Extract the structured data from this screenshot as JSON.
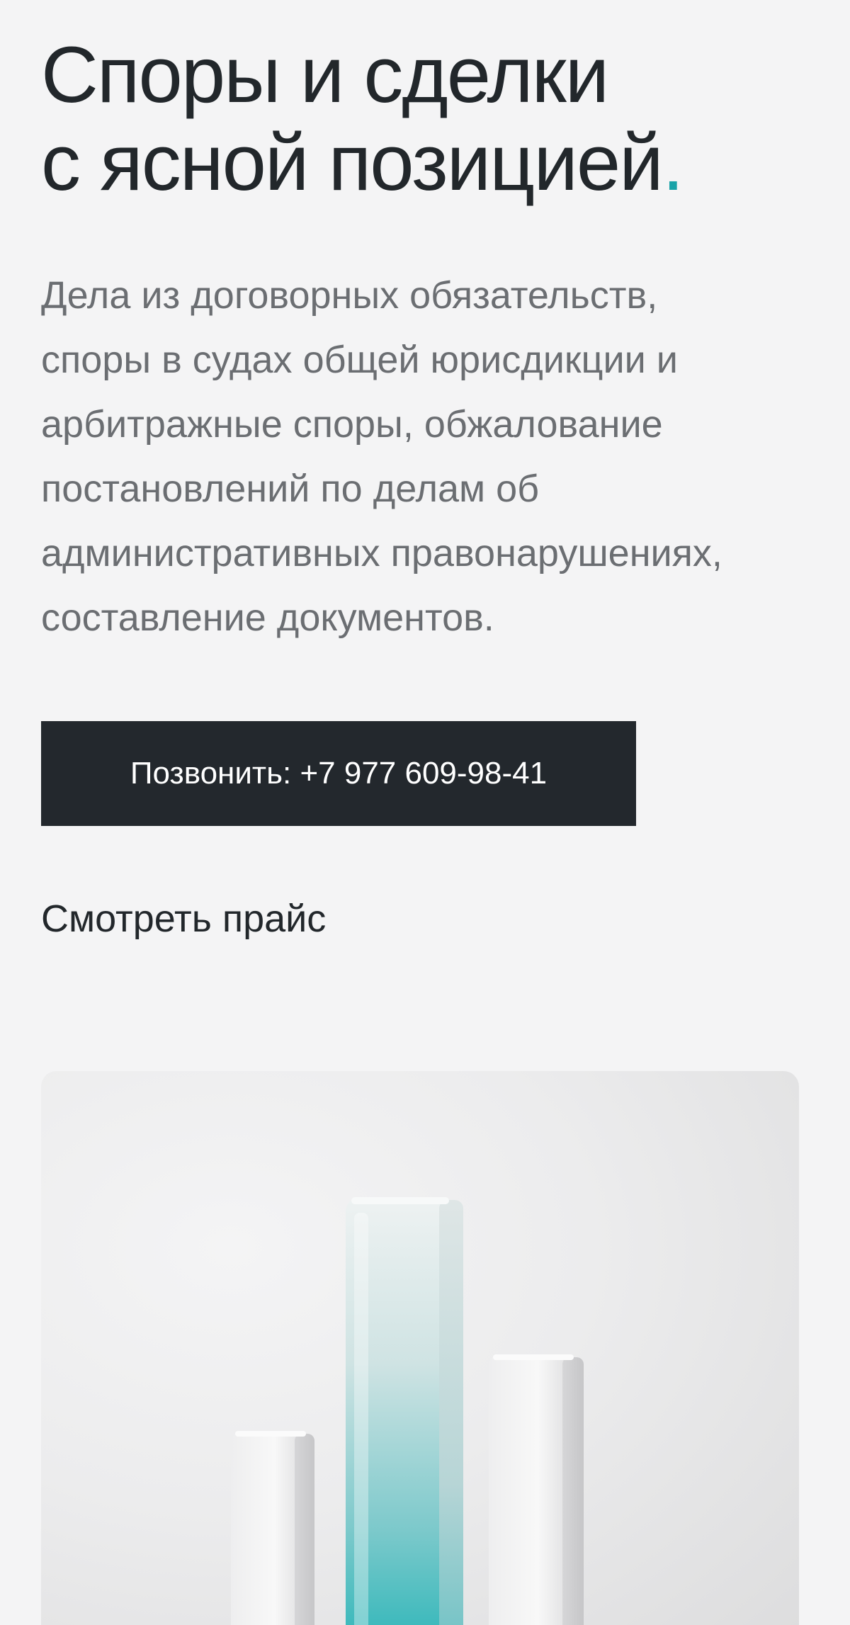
{
  "hero": {
    "title_line1": "Споры и сделки",
    "title_line2": "с ясной позицией",
    "title_dot": ".",
    "description_lines": [
      "Дела из договорных обязательств,",
      "споры в судах общей юрисдикции и",
      "арбитражные споры, обжалование",
      "постановлений по делам об",
      "административных правонарушениях,",
      "составление документов."
    ]
  },
  "actions": {
    "call_label": "Позвонить: +7 977 609-98-41",
    "price_label": "Смотреть прайс"
  },
  "colors": {
    "accent": "#19a3a8",
    "button_bg": "#23282d",
    "page_bg": "#f4f4f5",
    "body_text": "#6b6e72"
  }
}
